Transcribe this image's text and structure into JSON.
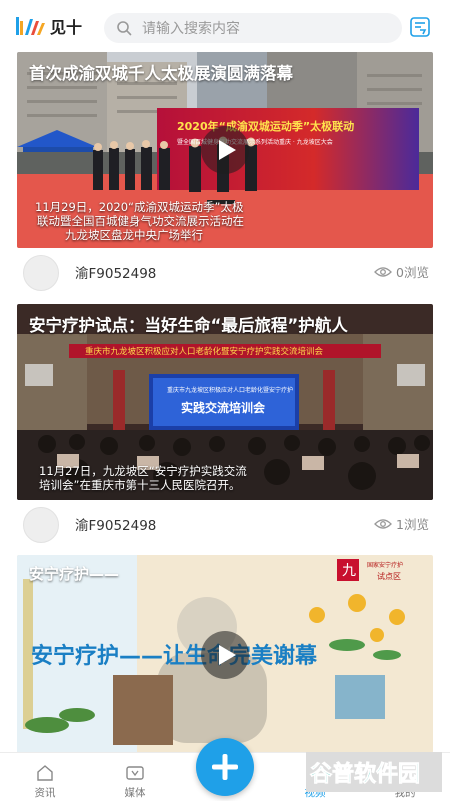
{
  "app": {
    "logo_text": "见十"
  },
  "search": {
    "placeholder": "请输入搜索内容"
  },
  "feed": [
    {
      "title": "首次成渝双城千人太极展演圆满落幕",
      "banner_line1": "2020年“成渝双城运动季”太极联动",
      "banner_line2": "暨全国百城健身气功交流展示系列活动重庆 · 九龙坡区大会",
      "caption_lines": [
        "11月29日，2020“成渝双城运动季”太极",
        "联动暨全国百城健身气功交流展示活动在",
        "九龙坡区盘龙中央广场举行"
      ],
      "author": "渝F9052498",
      "views": "0浏览"
    },
    {
      "title": "安宁疗护试点：当好生命“最后旅程”护航人",
      "banner_text": "重庆市九龙坡区积极应对人口老龄化暨安宁疗护实践交流培训会",
      "screen_line1": "重庆市九龙坡区积极应对人口老龄化暨安宁疗护",
      "screen_line2": "实践交流培训会",
      "caption_lines": [
        "11月27日，九龙坡区“安宁疗护实践交流",
        "培训会”在重庆市第十三人民医院召开。"
      ],
      "author": "渝F9052498",
      "views": "1浏览"
    },
    {
      "title": "安宁疗护——",
      "headline": "安宁疗护——让生命完美谢幕",
      "seal_char": "九",
      "badge_line1": "国家安宁疗护",
      "badge_line2": "试点区"
    }
  ],
  "tabs": [
    {
      "label": "资讯",
      "icon": "news-icon"
    },
    {
      "label": "媒体",
      "icon": "tv-icon"
    },
    {
      "label": "视频",
      "icon": "video-icon"
    },
    {
      "label": "我的",
      "icon": "profile-icon"
    }
  ],
  "watermark": {
    "text": "谷普软件园"
  },
  "colors": {
    "accent": "#1fa0e8",
    "active_tab": "#1fa0e8",
    "red_banner": "#c8102e"
  }
}
